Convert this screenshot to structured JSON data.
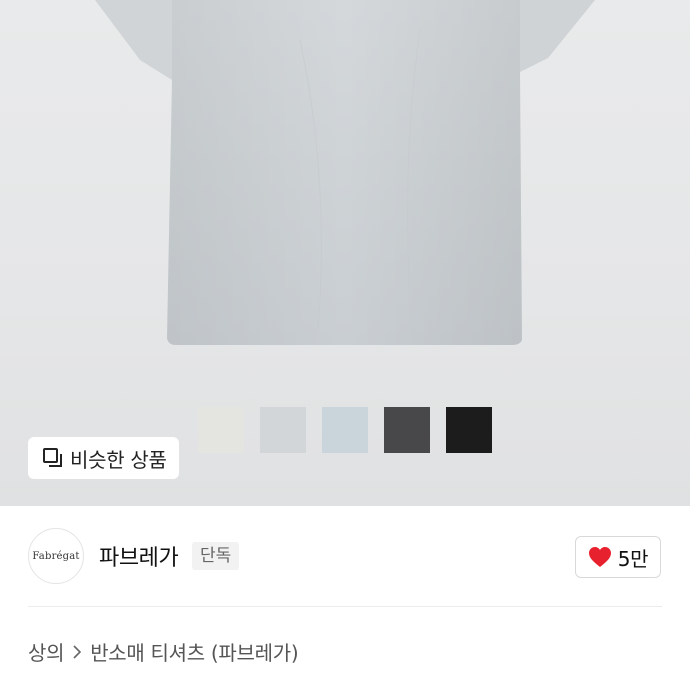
{
  "product_image": {
    "swatches": [
      {
        "name": "light-beige",
        "color": "#e4e4e1"
      },
      {
        "name": "light-gray",
        "color": "#d3d6d9"
      },
      {
        "name": "sky-gray",
        "color": "#c9d5da"
      },
      {
        "name": "charcoal",
        "color": "#48484a"
      },
      {
        "name": "black",
        "color": "#1c1c1c"
      }
    ],
    "similar_button_label": "비슷한 상품",
    "similar_icon": "similar-items-icon",
    "shirt_color": "#ced3d7"
  },
  "brand": {
    "logo_text": "Fabrégat",
    "name": "파브레가",
    "badge": "단독"
  },
  "like": {
    "count": "5만",
    "icon": "heart-icon",
    "color": "#e8212e"
  },
  "breadcrumb": {
    "items": [
      "상의",
      "반소매 티셔츠 (파브레가)"
    ],
    "separator_icon": "chevron-right-icon"
  }
}
